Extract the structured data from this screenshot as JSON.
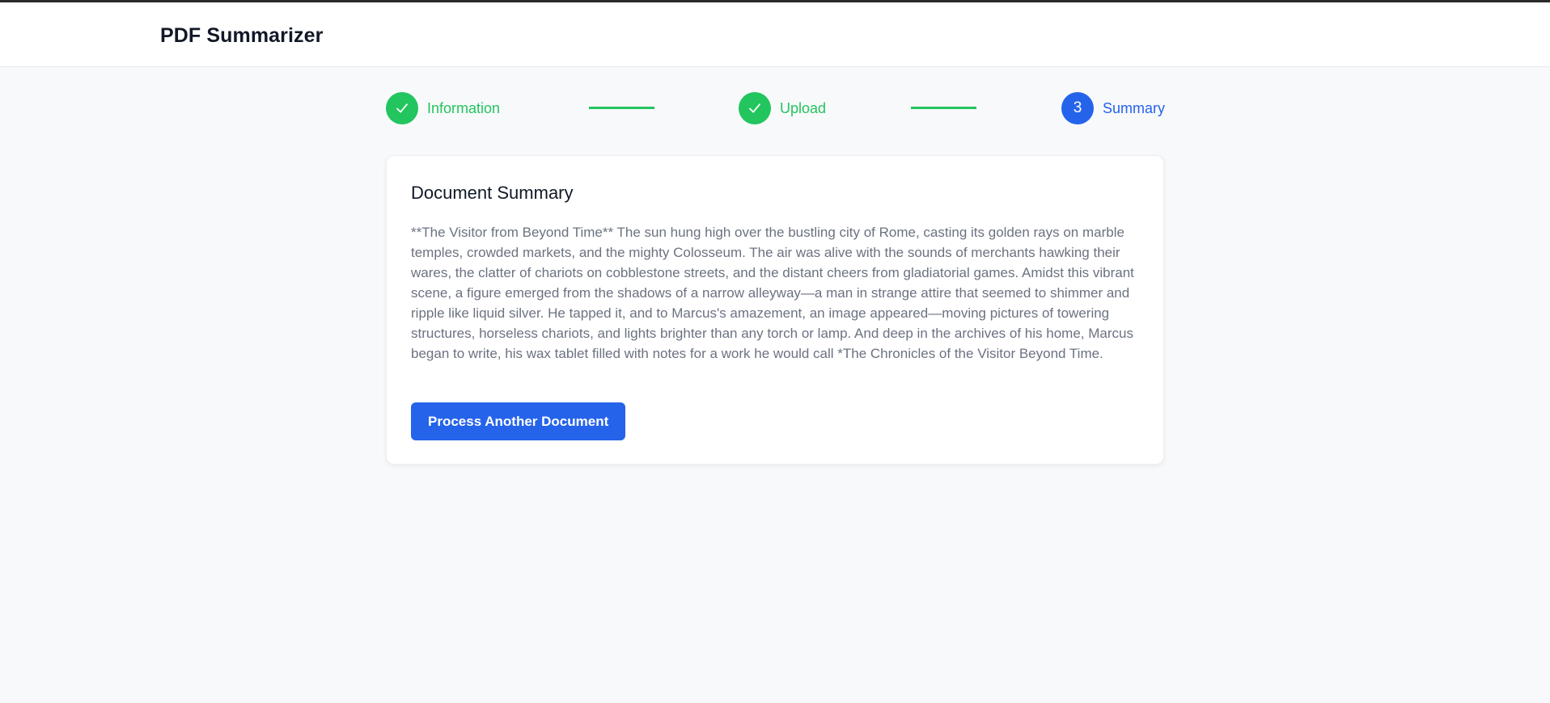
{
  "app": {
    "title": "PDF Summarizer"
  },
  "stepper": {
    "steps": [
      {
        "label": "Information",
        "status": "completed",
        "icon": "check-icon"
      },
      {
        "label": "Upload",
        "status": "completed",
        "icon": "check-icon"
      },
      {
        "label": "Summary",
        "status": "active",
        "number": "3"
      }
    ]
  },
  "summary_card": {
    "title": "Document Summary",
    "text": "**The Visitor from Beyond Time** The sun hung high over the bustling city of Rome, casting its golden rays on marble temples, crowded markets, and the mighty Colosseum. The air was alive with the sounds of merchants hawking their wares, the clatter of chariots on cobblestone streets, and the distant cheers from gladiatorial games. Amidst this vibrant scene, a figure emerged from the shadows of a narrow alleyway—a man in strange attire that seemed to shimmer and ripple like liquid silver. He tapped it, and to Marcus's amazement, an image appeared—moving pictures of towering structures, horseless chariots, and lights brighter than any torch or lamp. And deep in the archives of his home, Marcus began to write, his wax tablet filled with notes for a work he would call *The Chronicles of the Visitor Beyond Time.",
    "button_label": "Process Another Document"
  },
  "colors": {
    "completed": "#22c55e",
    "active": "#2563eb",
    "title_text": "#111827",
    "body_text": "#6b7280",
    "page_background": "#f8f9fb"
  }
}
